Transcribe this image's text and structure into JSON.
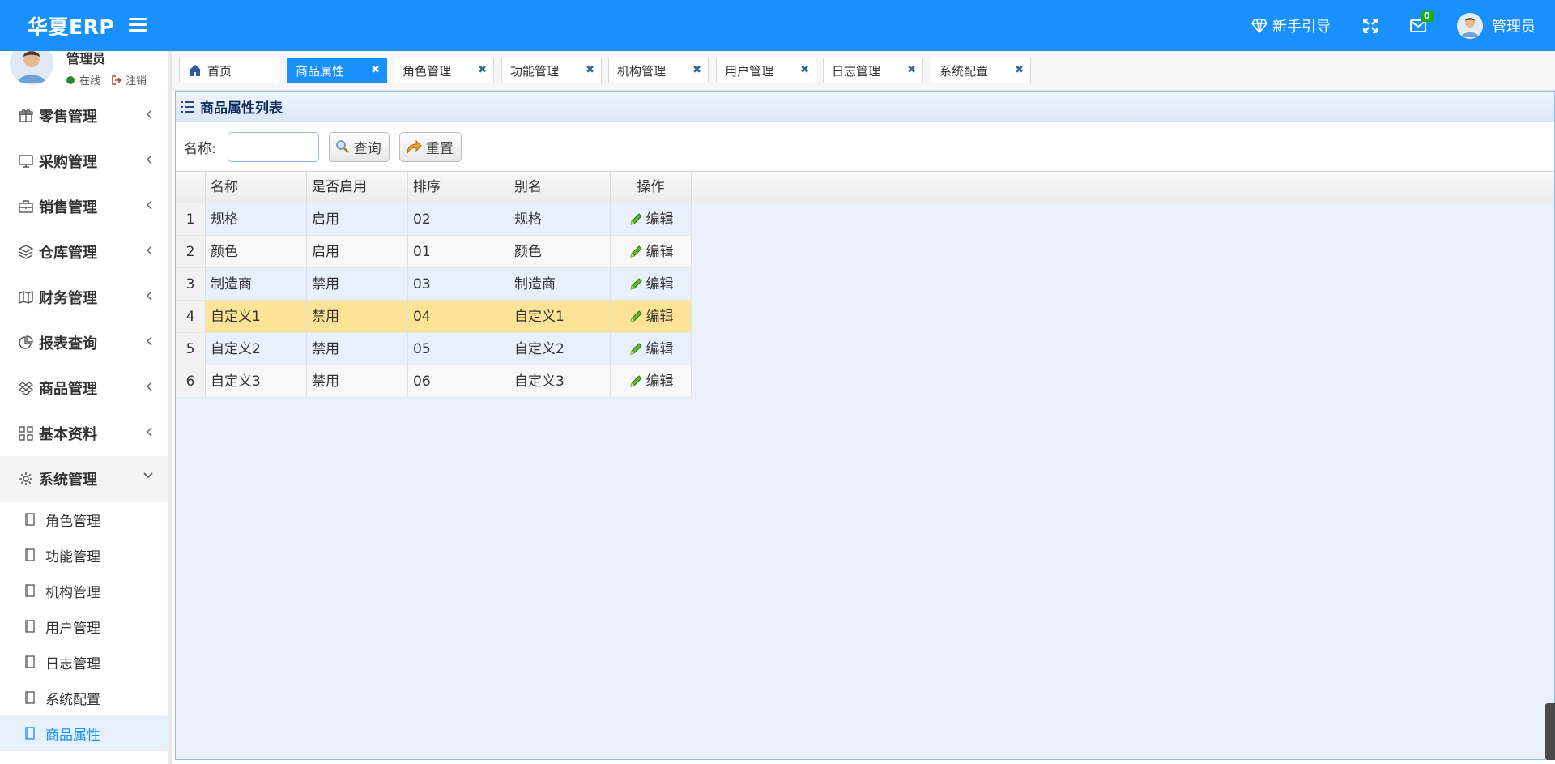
{
  "app": {
    "logo": "华夏ERP"
  },
  "topbar": {
    "guide_label": "新手引导",
    "mail_count": "0",
    "user_name": "管理员"
  },
  "user_panel": {
    "name": "管理员",
    "status": "在线",
    "logout": "注销"
  },
  "sidebar": {
    "items": [
      {
        "label": "零售管理",
        "icon": "gift-icon"
      },
      {
        "label": "采购管理",
        "icon": "monitor-icon"
      },
      {
        "label": "销售管理",
        "icon": "briefcase-icon"
      },
      {
        "label": "仓库管理",
        "icon": "layers-icon"
      },
      {
        "label": "财务管理",
        "icon": "map-icon"
      },
      {
        "label": "报表查询",
        "icon": "pie-icon"
      },
      {
        "label": "商品管理",
        "icon": "dropbox-icon"
      },
      {
        "label": "基本资料",
        "icon": "grid-icon"
      },
      {
        "label": "系统管理",
        "icon": "gear-icon"
      }
    ],
    "sub_items": [
      "角色管理",
      "功能管理",
      "机构管理",
      "用户管理",
      "日志管理",
      "系统配置",
      "商品属性"
    ]
  },
  "tabs": [
    "首页",
    "商品属性",
    "角色管理",
    "功能管理",
    "机构管理",
    "用户管理",
    "日志管理",
    "系统配置"
  ],
  "panel": {
    "title": "商品属性列表",
    "search_label": "名称:",
    "search_value": "",
    "query_button": "查询",
    "reset_button": "重置"
  },
  "table": {
    "columns": [
      "名称",
      "是否启用",
      "排序",
      "别名",
      "操作"
    ],
    "rows": [
      {
        "num": "1",
        "name": "规格",
        "enabled": "启用",
        "sort": "02",
        "alias": "规格",
        "action": "编辑"
      },
      {
        "num": "2",
        "name": "颜色",
        "enabled": "启用",
        "sort": "01",
        "alias": "颜色",
        "action": "编辑"
      },
      {
        "num": "3",
        "name": "制造商",
        "enabled": "禁用",
        "sort": "03",
        "alias": "制造商",
        "action": "编辑"
      },
      {
        "num": "4",
        "name": "自定义1",
        "enabled": "禁用",
        "sort": "04",
        "alias": "自定义1",
        "action": "编辑"
      },
      {
        "num": "5",
        "name": "自定义2",
        "enabled": "禁用",
        "sort": "05",
        "alias": "自定义2",
        "action": "编辑"
      },
      {
        "num": "6",
        "name": "自定义3",
        "enabled": "禁用",
        "sort": "06",
        "alias": "自定义3",
        "action": "编辑"
      }
    ],
    "selected_row": 3
  },
  "colors": {
    "primary": "#1890ff",
    "selected_row": "#fde396",
    "even_row": "#e8f0fb",
    "odd_row": "#f8f8f8"
  }
}
